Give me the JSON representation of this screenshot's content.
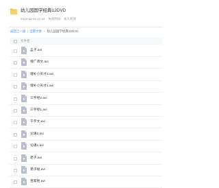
{
  "header": {
    "title": "幼儿园国学经典12DVD",
    "created": "2013-12-03 21:44",
    "expiry_label": "失效时间：",
    "expiry_value": "永久有效"
  },
  "breadcrumb": {
    "back": "返回上一级",
    "all_files": "全部文件",
    "current": "幼儿园国学经典12DVD",
    "separator": "|",
    "arrow": ">"
  },
  "list": {
    "column_name": "文件名",
    "files": [
      {
        "name": "孟子.avi"
      },
      {
        "name": "增广贤文.avi"
      },
      {
        "name": "增补小天才3.avi"
      },
      {
        "name": "增补小天才1.avi"
      },
      {
        "name": "三字经2.avi"
      },
      {
        "name": "三字经1.avi"
      },
      {
        "name": "千字文.avi"
      },
      {
        "name": "论语2.avi"
      },
      {
        "name": "论语1.avi"
      },
      {
        "name": "老子.avi"
      },
      {
        "name": "弟子规.avi"
      },
      {
        "name": "百家姓.avi"
      }
    ]
  },
  "colors": {
    "folder": "#f9c034",
    "link": "#3b8cff",
    "file_icon": "#b7bec9"
  }
}
